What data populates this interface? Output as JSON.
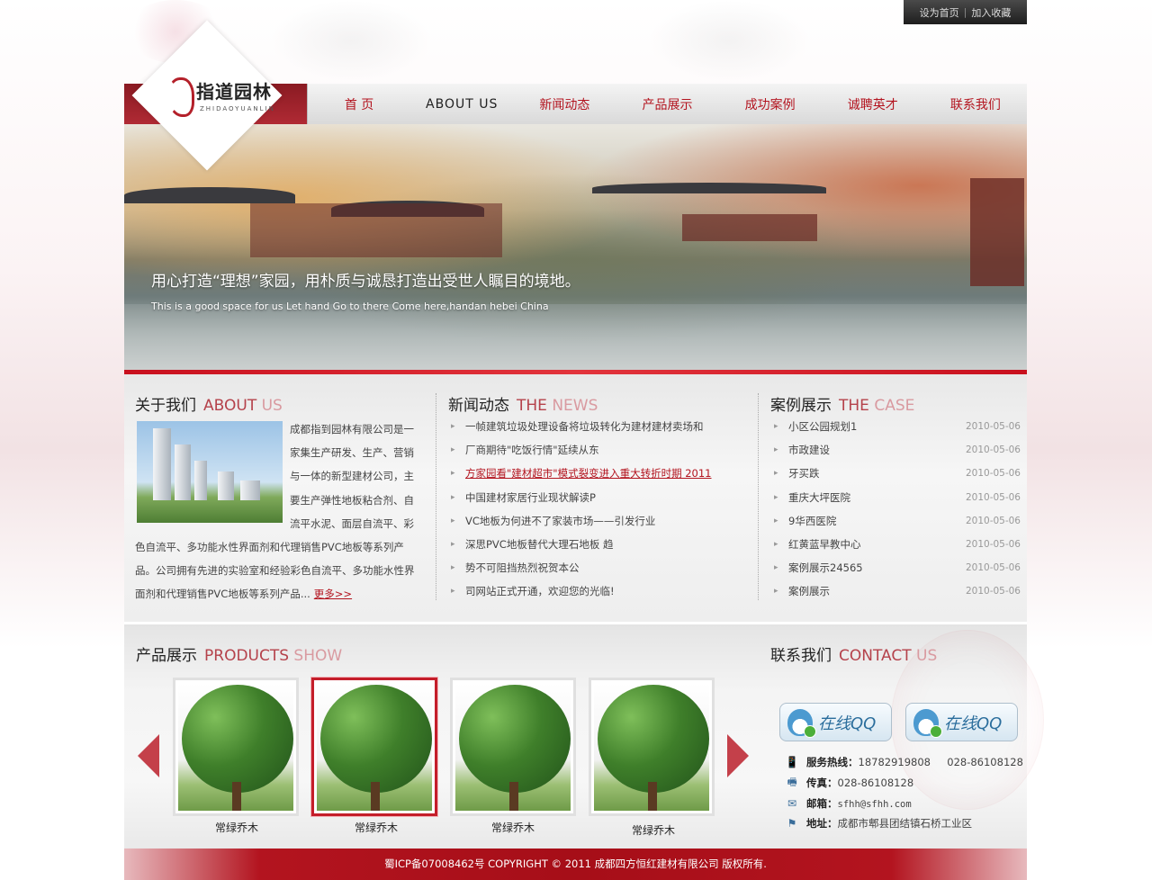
{
  "util": {
    "home": "设为首页",
    "sep": "|",
    "fav": "加入收藏"
  },
  "logo": {
    "cn": "指道园林",
    "en": "ZHIDAOYUANLIN"
  },
  "nav": [
    "首 页",
    "ABOUT US",
    "新闻动态",
    "产品展示",
    "成功案例",
    "诚聘英才",
    "联系我们"
  ],
  "banner": {
    "title": "用心打造“理想”家园，用朴质与诚恳打造出受世人瞩目的境地。",
    "subtitle": "This is a good space for us Let hand Go to there Come here,handan hebei China"
  },
  "about": {
    "title_cn": "关于我们",
    "title_en1": "ABOUT",
    "title_en2": " US",
    "text": "成都指到园林有限公司是一家集生产研发、生产、营销与一体的新型建材公司，主要生产弹性地板粘合剂、自流平水泥、面层自流平、彩色自流平、多功能水性界面剂和代理销售PVC地板等系列产品。公司拥有先进的实验室和经验彩色自流平、多功能水性界面剂和代理销售PVC地板等系列产品...",
    "more": "更多>>"
  },
  "news": {
    "title_cn": "新闻动态",
    "title_en1": "THE",
    "title_en2": " NEWS",
    "items": [
      "一帧建筑垃圾处理设备将垃圾转化为建材建材卖场和",
      "厂商期待\"吃饭行情\"延续从东",
      "方家园看\"建材超市\"模式裂变进入重大转折时期 2011",
      "中国建材家居行业现状解读P",
      "VC地板为何进不了家装市场——引发行业",
      "深思PVC地板替代大理石地板 趋",
      "势不可阻挡热烈祝贺本公",
      "司网站正式开通，欢迎您的光临!"
    ]
  },
  "cases": {
    "title_cn": "案例展示",
    "title_en1": "THE",
    "title_en2": " CASE",
    "items": [
      {
        "name": "小区公园规划1",
        "date": "2010-05-06"
      },
      {
        "name": "市政建设",
        "date": "2010-05-06"
      },
      {
        "name": "牙买跌",
        "date": "2010-05-06"
      },
      {
        "name": "重庆大坪医院",
        "date": "2010-05-06"
      },
      {
        "name": "9华西医院",
        "date": "2010-05-06"
      },
      {
        "name": "红黄蓝早教中心",
        "date": "2010-05-06"
      },
      {
        "name": "案例展示24565",
        "date": "2010-05-06"
      },
      {
        "name": "案例展示",
        "date": "2010-05-06"
      }
    ]
  },
  "products": {
    "title_cn": "产品展示",
    "title_en1": "PRODUCTS",
    "title_en2": " SHOW",
    "items": [
      "常绿乔木",
      "常绿乔木",
      "常绿乔木",
      "常绿乔木"
    ]
  },
  "contact": {
    "title_cn": "联系我们",
    "title_en1": "CONTACT",
    "title_en2": " US",
    "qq1": "在线QQ",
    "qq2": "在线QQ",
    "hotline_label": "服务热线：",
    "hotline": "18782919808     028-86108128",
    "fax_label": "传真：",
    "fax": "028-86108128",
    "email_label": "邮箱：",
    "email": "sfhh@sfhh.com",
    "address_label": "地址：",
    "address": "成都市郫县团结镇石桥工业区"
  },
  "footer": "蜀ICP备07008462号 COPYRIGHT © 2011 成都四方恒红建材有限公司 版权所有."
}
